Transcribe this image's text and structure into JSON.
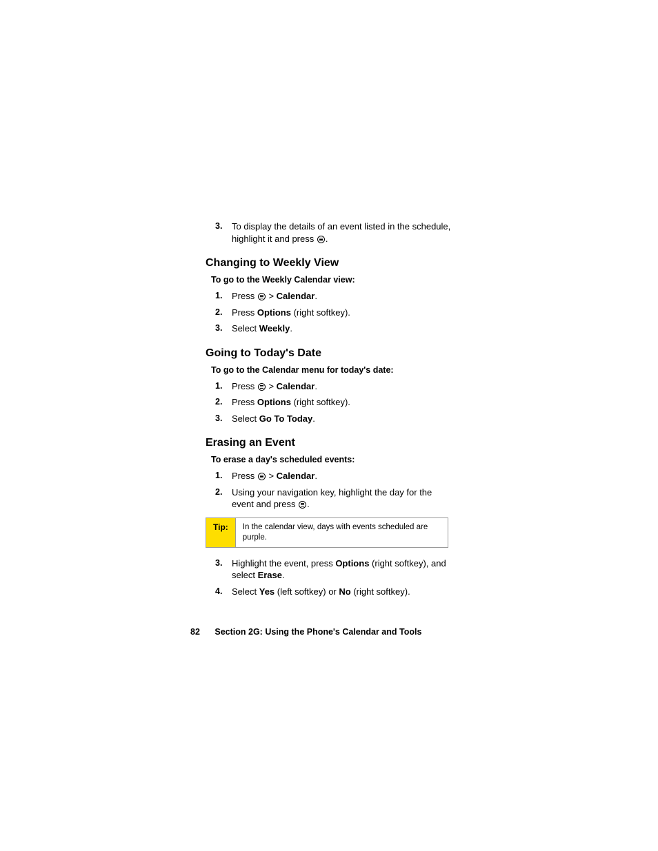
{
  "intro_step": {
    "num": "3.",
    "text_before": "To display the details of an event listed in the schedule, highlight it and press ",
    "text_after": "."
  },
  "sections": [
    {
      "heading": "Changing to Weekly View",
      "subhead": "To go to the Weekly Calendar view:",
      "steps": [
        {
          "num": "1.",
          "prefix": "Press ",
          "has_icon": true,
          "post_icon": " > ",
          "bold1": "Calendar",
          "suffix": "."
        },
        {
          "num": "2.",
          "prefix": "Press ",
          "bold1": "Options",
          "suffix": " (right softkey)."
        },
        {
          "num": "3.",
          "prefix": "Select ",
          "bold1": "Weekly",
          "suffix": "."
        }
      ]
    },
    {
      "heading": "Going to Today's Date",
      "subhead": "To go to the Calendar menu for today's date:",
      "steps": [
        {
          "num": "1.",
          "prefix": "Press ",
          "has_icon": true,
          "post_icon": " > ",
          "bold1": "Calendar",
          "suffix": "."
        },
        {
          "num": "2.",
          "prefix": "Press ",
          "bold1": "Options",
          "suffix": " (right softkey)."
        },
        {
          "num": "3.",
          "prefix": "Select ",
          "bold1": "Go To Today",
          "suffix": "."
        }
      ]
    },
    {
      "heading": "Erasing an Event",
      "subhead": "To erase a day's scheduled events:",
      "steps_pre_tip": [
        {
          "num": "1.",
          "prefix": "Press ",
          "has_icon": true,
          "post_icon": " > ",
          "bold1": "Calendar",
          "suffix": "."
        },
        {
          "num": "2.",
          "prefix": "Using your navigation key, highlight the day for the event and press ",
          "has_icon_end": true,
          "suffix": "."
        }
      ],
      "tip": {
        "label": "Tip:",
        "text": "In the calendar view, days with events scheduled are purple."
      },
      "steps_post_tip": [
        {
          "num": "3.",
          "prefix": "Highlight the event, press ",
          "bold1": "Options",
          "mid1": " (right softkey), and select ",
          "bold2": "Erase",
          "suffix": "."
        },
        {
          "num": "4.",
          "prefix": "Select ",
          "bold1": "Yes",
          "mid1": " (left softkey) or ",
          "bold2": "No",
          "suffix": " (right softkey)."
        }
      ]
    }
  ],
  "footer": {
    "page": "82",
    "section": "Section 2G: Using the Phone's Calendar and Tools"
  }
}
